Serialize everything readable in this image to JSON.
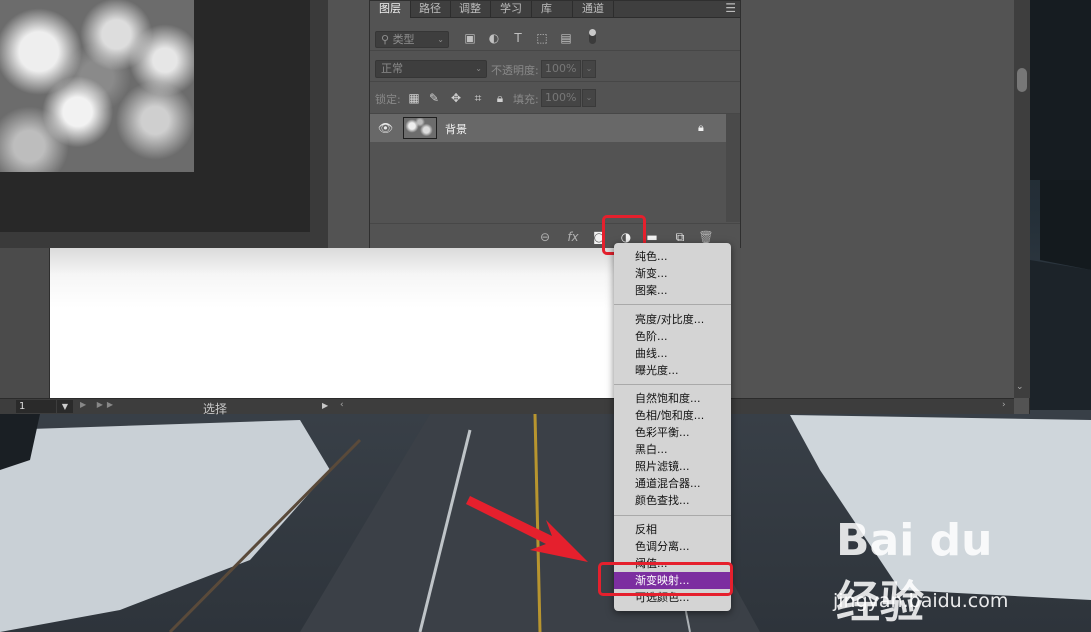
{
  "panel": {
    "tabs": [
      {
        "label": "图层",
        "active": true
      },
      {
        "label": "路径",
        "active": false
      },
      {
        "label": "调整",
        "active": false
      },
      {
        "label": "学习",
        "active": false
      },
      {
        "label": "库",
        "active": false
      },
      {
        "label": "通道",
        "active": false
      }
    ],
    "kind_filter_label": "类型",
    "blend_mode": "正常",
    "opacity_label": "不透明度:",
    "opacity_value": "100%",
    "lock_label": "锁定:",
    "fill_label": "填充:",
    "fill_value": "100%",
    "layer_name": "背景"
  },
  "status_bar": {
    "zoom_value": "1",
    "status_text": "选择"
  },
  "adjustment_menu": {
    "groups": [
      [
        "纯色...",
        "渐变...",
        "图案..."
      ],
      [
        "亮度/对比度...",
        "色阶...",
        "曲线...",
        "曝光度..."
      ],
      [
        "自然饱和度...",
        "色相/饱和度...",
        "色彩平衡...",
        "黑白...",
        "照片滤镜...",
        "通道混合器...",
        "颜色查找..."
      ],
      [
        "反相",
        "色调分离...",
        "阈值...",
        "渐变映射...",
        "可选颜色..."
      ]
    ],
    "selected_item": "渐变映射..."
  },
  "watermark": {
    "logo": "Bai du 经验",
    "url": "jingyan.baidu.com"
  },
  "colors": {
    "highlight": "#e5202d",
    "menu_selected": "#7c2ea0"
  }
}
